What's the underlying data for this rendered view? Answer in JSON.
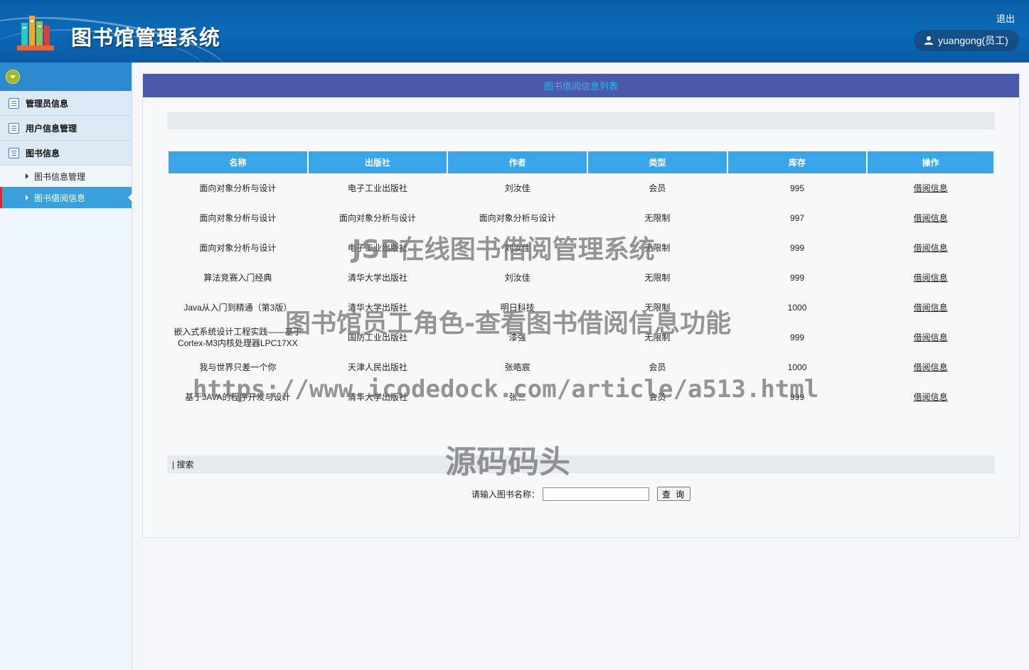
{
  "header": {
    "title": "图书馆管理系统",
    "logout_label": "退出",
    "user_label": "yuangong(员工)"
  },
  "sidebar": {
    "groups": [
      {
        "label": "管理员信息"
      },
      {
        "label": "用户信息管理"
      },
      {
        "label": "图书信息"
      }
    ],
    "sub_items": [
      {
        "label": "图书信息管理"
      },
      {
        "label": "图书借阅信息"
      }
    ]
  },
  "main": {
    "panel_title": "图书借阅信息列表",
    "columns": [
      "名称",
      "出版社",
      "作者",
      "类型",
      "库存",
      "操作"
    ],
    "rows": [
      [
        "面向对象分析与设计",
        "电子工业出版社",
        "刘汝佳",
        "会员",
        "995",
        "借阅信息"
      ],
      [
        "面向对象分析与设计",
        "面向对象分析与设计",
        "面向对象分析与设计",
        "无限制",
        "997",
        "借阅信息"
      ],
      [
        "面向对象分析与设计",
        "电子工业出版社",
        "刘汝佳",
        "无限制",
        "999",
        "借阅信息"
      ],
      [
        "算法竞赛入门经典",
        "清华大学出版社",
        "刘汝佳",
        "无限制",
        "999",
        "借阅信息"
      ],
      [
        "Java从入门到精通（第3版）",
        "清华大学出版社",
        "明日科技",
        "无限制",
        "1000",
        "借阅信息"
      ],
      [
        "嵌入式系统设计工程实践——基于Cortex-M3内核处理器LPC17XX",
        "国防工业出版社",
        "漆强",
        "无限制",
        "999",
        "借阅信息"
      ],
      [
        "我与世界只差一个你",
        "天津人民出版社",
        "张皓宸",
        "会员",
        "1000",
        "借阅信息"
      ],
      [
        "基于JAVA的程序开发与设计",
        "清华大学出版社",
        "张三",
        "会员",
        "999",
        "借阅信息"
      ]
    ],
    "search_section_label": "| 搜索",
    "search_prompt": "请输入图书名称：",
    "search_input_value": "",
    "search_button_label": "查 询"
  },
  "watermarks": {
    "line1": "JSP在线图书借阅管理系统",
    "line2": "图书馆员工角色-查看图书借阅信息功能",
    "line3": "https://www.icodedock.com/article/a513.html",
    "line4": "源码码头"
  },
  "colors": {
    "header_blue": "#0b6ab8",
    "panel_title_bg": "#4a59a8",
    "panel_title_text": "#2ab6f0",
    "table_header_bg": "#3aa6ea",
    "active_menu_bg": "#3aa0dc",
    "active_marker": "#d92b2b"
  },
  "icons": {
    "logo": "books-logo-icon",
    "user": "user-icon",
    "toggle": "chevron-down-circle-icon",
    "group": "list-icon",
    "sub_arrow": "caret-right-icon"
  }
}
